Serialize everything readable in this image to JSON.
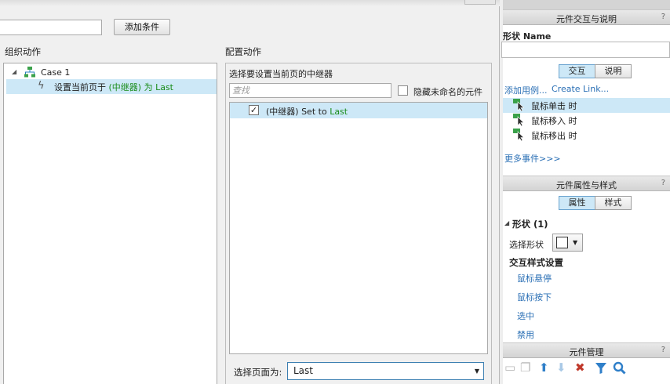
{
  "dialog": {
    "add_condition_button": "添加条件",
    "organize_actions_title": "组织动作",
    "configure_actions_title": "配置动作",
    "tree": {
      "case_label": "Case 1",
      "action": {
        "prefix": "设置当前页于 ",
        "target": "(中继器) 为 Last"
      }
    },
    "config": {
      "select_repeater_label": "选择要设置当前页的中继器",
      "search_placeholder": "查找",
      "hide_unnamed_label": "隐藏未命名的元件",
      "repeater_row": {
        "checked": true,
        "name": "(中继器) Set to ",
        "value": "Last"
      },
      "page_select_label": "选择页面为:",
      "page_select_value": "Last"
    }
  },
  "right_panel": {
    "interaction_header": "元件交互与说明",
    "help_icon": "?",
    "shape_name_title": "形状 Name",
    "tabs_interaction": [
      "交互",
      "说明"
    ],
    "add_case_link": "添加用例...",
    "create_link": "Create Link...",
    "events": [
      "鼠标单击 时",
      "鼠标移入 时",
      "鼠标移出 时"
    ],
    "more_events_link": "更多事件>>>",
    "props_header": "元件属性与样式",
    "tabs_props": [
      "属性",
      "样式"
    ],
    "shape_section_title": "形状 (1)",
    "select_shape_label": "选择形状",
    "interaction_style_title": "交互样式设置",
    "style_links": [
      "鼠标悬停",
      "鼠标按下",
      "选中",
      "禁用"
    ],
    "widget_header": "元件管理",
    "toolbar_icons": [
      "page-icon",
      "duplicate-icon",
      "move-up-icon",
      "move-down-icon",
      "delete-icon",
      "filter-icon",
      "search-icon"
    ]
  },
  "colors": {
    "selection": "#cde8f7",
    "link": "#2a6fb5",
    "green_text": "#1a8c1a",
    "focus_border": "#3c7fb1"
  }
}
